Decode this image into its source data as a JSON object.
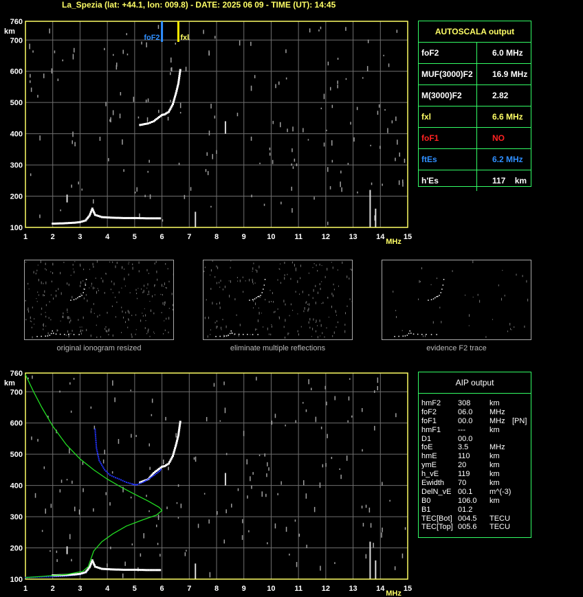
{
  "title": "La_Spezia (lat: +44.1, lon: 009.8) - DATE: 2025 06 09 - TIME (UT): 14:45",
  "colors": {
    "axis": "#ffff66",
    "grid": "#707070",
    "panel_border": "#33ff66",
    "trace": "#ffffff",
    "profile": "#22dd22",
    "blue_trace": "#2233ff",
    "foF2_marker": "#2f8fff",
    "fxl_marker": "#ffee00",
    "noise": "#a0a0a0"
  },
  "chart_data": [
    {
      "type": "scatter",
      "name": "autoscala-ionogram",
      "xlim": [
        1,
        15
      ],
      "ylim": [
        100,
        760
      ],
      "x_ticks": [
        1,
        2,
        3,
        4,
        5,
        6,
        7,
        8,
        9,
        10,
        11,
        12,
        13,
        14,
        15
      ],
      "y_ticks": [
        100,
        200,
        300,
        400,
        500,
        600,
        700,
        760
      ],
      "x_unit": "MHz",
      "y_unit": "km",
      "markers": [
        {
          "label": "foF2",
          "x": 6.0,
          "color": "#2f8fff"
        },
        {
          "label": "fxl",
          "x": 6.6,
          "color": "#ffee00"
        }
      ],
      "es_trace": [
        [
          2.0,
          112
        ],
        [
          2.4,
          113
        ],
        [
          2.8,
          115
        ],
        [
          3.0,
          117
        ],
        [
          3.2,
          122
        ],
        [
          3.35,
          138
        ],
        [
          3.45,
          160
        ],
        [
          3.55,
          140
        ],
        [
          3.8,
          133
        ],
        [
          4.2,
          131
        ],
        [
          4.6,
          130
        ],
        [
          5.0,
          130
        ],
        [
          5.5,
          129
        ],
        [
          6.0,
          129
        ]
      ],
      "f2_trace": [
        [
          5.2,
          428
        ],
        [
          5.5,
          433
        ],
        [
          5.7,
          440
        ],
        [
          5.85,
          450
        ],
        [
          6.0,
          460
        ],
        [
          6.1,
          462
        ],
        [
          6.25,
          470
        ],
        [
          6.4,
          495
        ],
        [
          6.5,
          525
        ],
        [
          6.6,
          560
        ],
        [
          6.68,
          610
        ]
      ]
    },
    {
      "type": "line",
      "name": "aip-profile",
      "xlim": [
        1,
        15
      ],
      "ylim": [
        100,
        760
      ],
      "x_ticks": [
        1,
        2,
        3,
        4,
        5,
        6,
        7,
        8,
        9,
        10,
        11,
        12,
        13,
        14,
        15
      ],
      "y_ticks": [
        100,
        200,
        300,
        400,
        500,
        600,
        700,
        760
      ],
      "x_unit": "MHz",
      "y_unit": "km",
      "profile": [
        [
          1.0,
          755
        ],
        [
          1.3,
          700
        ],
        [
          1.6,
          650
        ],
        [
          2.0,
          590
        ],
        [
          2.5,
          530
        ],
        [
          3.0,
          485
        ],
        [
          3.5,
          450
        ],
        [
          4.0,
          420
        ],
        [
          4.5,
          395
        ],
        [
          5.0,
          372
        ],
        [
          5.5,
          350
        ],
        [
          5.9,
          330
        ],
        [
          6.0,
          320
        ],
        [
          5.8,
          305
        ],
        [
          5.3,
          290
        ],
        [
          4.7,
          270
        ],
        [
          4.2,
          245
        ],
        [
          3.8,
          220
        ],
        [
          3.5,
          190
        ],
        [
          3.4,
          165
        ],
        [
          3.3,
          140
        ],
        [
          3.1,
          125
        ],
        [
          2.5,
          115
        ],
        [
          1.5,
          108
        ],
        [
          1.0,
          105
        ]
      ],
      "blue_trace": [
        [
          3.55,
          580
        ],
        [
          3.6,
          520
        ],
        [
          3.7,
          480
        ],
        [
          3.9,
          450
        ],
        [
          4.1,
          433
        ],
        [
          4.3,
          425
        ],
        [
          4.5,
          418
        ],
        [
          4.7,
          410
        ],
        [
          4.9,
          405
        ],
        [
          5.0,
          402
        ],
        [
          5.1,
          403
        ],
        [
          5.3,
          410
        ],
        [
          5.5,
          420
        ],
        [
          5.7,
          432
        ],
        [
          5.9,
          445
        ],
        [
          6.0,
          455
        ]
      ],
      "blue_low": [
        [
          1.0,
          105
        ],
        [
          1.5,
          107
        ],
        [
          2.0,
          108
        ],
        [
          2.5,
          110
        ],
        [
          3.0,
          115
        ],
        [
          3.3,
          125
        ]
      ],
      "es_trace": [
        [
          2.0,
          112
        ],
        [
          2.4,
          113
        ],
        [
          2.8,
          115
        ],
        [
          3.0,
          117
        ],
        [
          3.2,
          122
        ],
        [
          3.35,
          138
        ],
        [
          3.45,
          160
        ],
        [
          3.55,
          140
        ],
        [
          3.8,
          133
        ],
        [
          4.2,
          131
        ],
        [
          4.6,
          130
        ],
        [
          5.0,
          130
        ],
        [
          5.5,
          129
        ],
        [
          6.0,
          129
        ]
      ],
      "f2_trace": [
        [
          5.2,
          410
        ],
        [
          5.5,
          420
        ],
        [
          5.7,
          440
        ],
        [
          5.85,
          450
        ],
        [
          6.0,
          460
        ],
        [
          6.1,
          462
        ],
        [
          6.25,
          470
        ],
        [
          6.4,
          495
        ],
        [
          6.5,
          525
        ],
        [
          6.6,
          560
        ],
        [
          6.68,
          610
        ]
      ]
    }
  ],
  "autoscala": {
    "heading": "AUTOSCALA output",
    "rows": [
      {
        "label": "foF2",
        "value": "6.0 MHz",
        "label_color": "#ffffff",
        "value_color": "#ffffff"
      },
      {
        "label": "MUF(3000)F2",
        "value": "16.9 MHz",
        "label_color": "#ffffff",
        "value_color": "#ffffff"
      },
      {
        "label": "M(3000)F2",
        "value": "2.82",
        "label_color": "#ffffff",
        "value_color": "#ffffff"
      },
      {
        "label": "fxl",
        "value": "6.6 MHz",
        "label_color": "#ffff66",
        "value_color": "#ffff66"
      },
      {
        "label": "foF1",
        "value": "NO",
        "label_color": "#ff2222",
        "value_color": "#ff2222"
      },
      {
        "label": "ftEs",
        "value": "6.2 MHz",
        "label_color": "#2f8fff",
        "value_color": "#2f8fff"
      },
      {
        "label": "h'Es",
        "value": "117    km",
        "label_color": "#ffffff",
        "value_color": "#ffffff"
      }
    ]
  },
  "thumbnails": [
    {
      "caption": "original ionogram resized"
    },
    {
      "caption": "eliminate multiple reflections"
    },
    {
      "caption": "evidence F2 trace"
    }
  ],
  "aip": {
    "heading": "AIP output",
    "rows": [
      {
        "name": "hmF2",
        "value": "308",
        "unit": "km",
        "extra": ""
      },
      {
        "name": "foF2",
        "value": "06.0",
        "unit": "MHz",
        "extra": ""
      },
      {
        "name": "foF1",
        "value": "00.0",
        "unit": "MHz",
        "extra": "[PN]"
      },
      {
        "name": "hmF1",
        "value": "---",
        "unit": "km",
        "extra": ""
      },
      {
        "name": "D1",
        "value": "00.0",
        "unit": "",
        "extra": ""
      },
      {
        "name": "foE",
        "value": "3.5",
        "unit": "MHz",
        "extra": ""
      },
      {
        "name": "hmE",
        "value": "110",
        "unit": "km",
        "extra": ""
      },
      {
        "name": "ymE",
        "value": "20",
        "unit": "km",
        "extra": ""
      },
      {
        "name": "h_vE",
        "value": "119",
        "unit": "km",
        "extra": ""
      },
      {
        "name": "Ewidth",
        "value": "70",
        "unit": "km",
        "extra": ""
      },
      {
        "name": "DelN_vE",
        "value": "00.1",
        "unit": "m^(-3)",
        "extra": ""
      },
      {
        "name": "B0",
        "value": "106.0",
        "unit": "km",
        "extra": ""
      },
      {
        "name": "B1",
        "value": "01.2",
        "unit": "",
        "extra": ""
      },
      {
        "name": "TEC[Bot]",
        "value": "004.5",
        "unit": "TECU",
        "extra": ""
      },
      {
        "name": "TEC[Top]",
        "value": "005.6",
        "unit": "TECU",
        "extra": ""
      }
    ]
  }
}
